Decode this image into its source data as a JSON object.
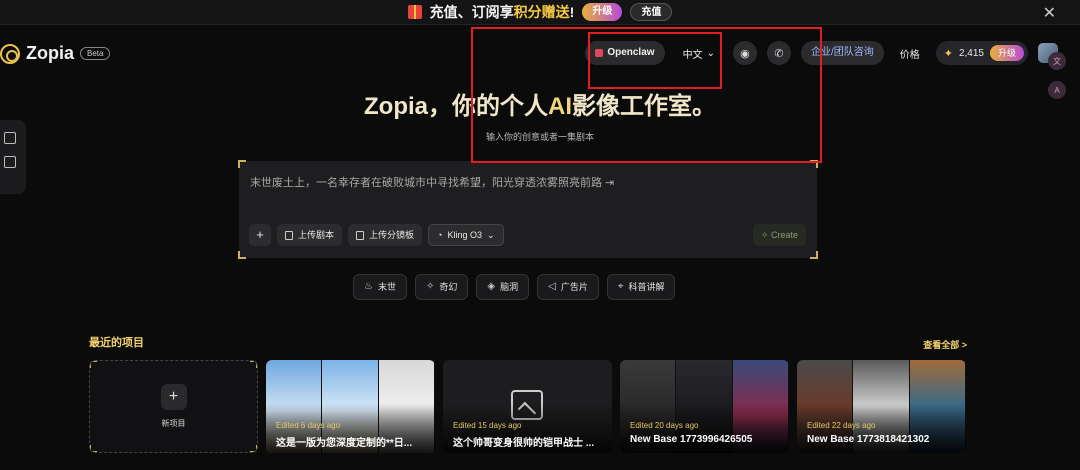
{
  "promo": {
    "text_prefix": "充值、订阅享",
    "text_highlight": "积分赠送",
    "text_suffix": "!",
    "upgrade_label": "升级",
    "charge_label": "充值",
    "close": "✕"
  },
  "header": {
    "brand": "Zopia",
    "beta": "Beta",
    "openclaw": "Openclaw",
    "language": "中文",
    "enterprise": "企业/团队咨询",
    "pricing": "价格",
    "credits": "2,415",
    "upgrade": "升级"
  },
  "hero": {
    "title_prefix": "Zopia，你的个人",
    "title_ai": "AI",
    "title_suffix": "影像工作室。",
    "subtitle": "输入你的创意或者一集剧本"
  },
  "composer": {
    "prompt": "末世废土上，一名幸存者在破败城市中寻找希望，阳光穿透浓雾照亮前路 ⇥",
    "upload_script": "上传剧本",
    "upload_storyboard": "上传分镜板",
    "model": "Kling O3",
    "create": "Create"
  },
  "categories": [
    {
      "label": "末世",
      "icon": "flame-icon"
    },
    {
      "label": "奇幻",
      "icon": "sparkle-icon"
    },
    {
      "label": "脑洞",
      "icon": "puzzle-icon"
    },
    {
      "label": "广告片",
      "icon": "megaphone-icon"
    },
    {
      "label": "科普讲解",
      "icon": "telescope-icon"
    }
  ],
  "recent": {
    "title": "最近的项目",
    "view_all": "查看全部 >",
    "new_project": "新项目",
    "cards": [
      {
        "edited": "Edited 6 days ago",
        "title": "这是一版为您深度定制的**日..."
      },
      {
        "edited": "Edited 15 days ago",
        "title": "这个帅哥变身很帅的铠甲战士 ..."
      },
      {
        "edited": "Edited 20 days ago",
        "title": "New Base 1773996426505"
      },
      {
        "edited": "Edited 22 days ago",
        "title": "New Base 1773818421302"
      }
    ]
  },
  "colors": {
    "accent_gold": "#f2d46b",
    "annotation_red": "#e02020"
  }
}
